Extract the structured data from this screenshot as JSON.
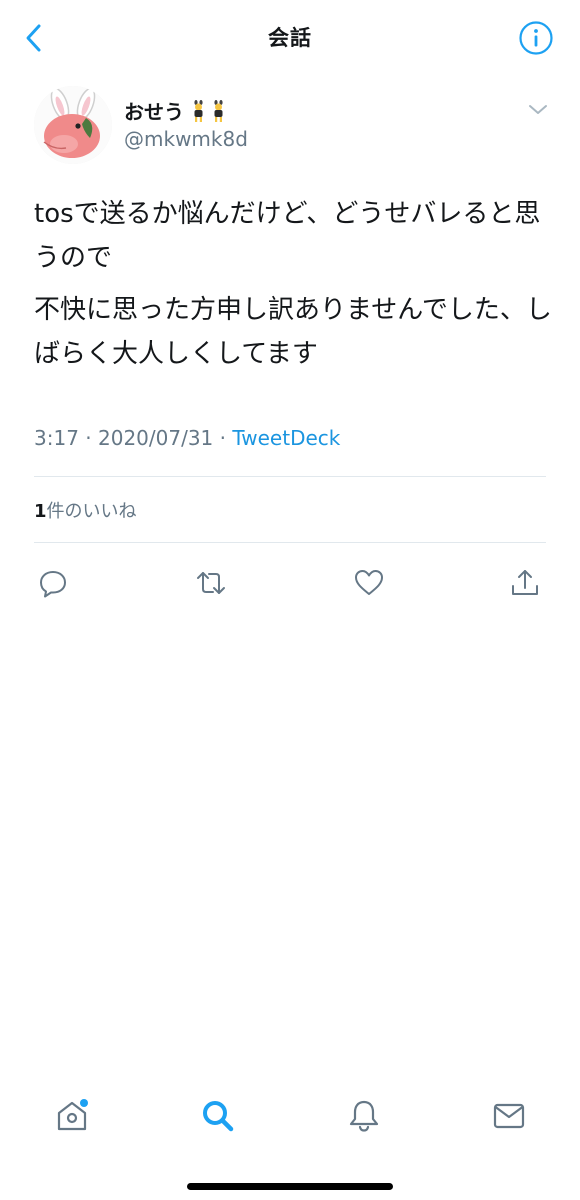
{
  "header": {
    "title": "会話",
    "back_icon": "chevron-left-icon",
    "info_icon": "info-icon"
  },
  "tweet": {
    "display_name": "おせう",
    "name_emoji": "dancers-emoji",
    "handle": "@mkwmk8d",
    "text_lines": [
      "tosで送るか悩んだけど、どうせバレると思うので",
      "不快に思った方申し訳ありませんでした、しばらく大人しくしてます"
    ],
    "time": "3:17",
    "date": "2020/07/31",
    "separator": "·",
    "client": "TweetDeck",
    "likes_count": "1",
    "likes_label": "件のいいね"
  },
  "actions": [
    "reply-icon",
    "retweet-icon",
    "like-icon",
    "share-icon"
  ],
  "tabbar": [
    "home-icon",
    "search-icon",
    "notifications-icon",
    "messages-icon"
  ],
  "colors": {
    "accent": "#1da1f2",
    "secondary_text": "#657786",
    "divider": "#e1e8ed",
    "icon_gray": "#657786"
  }
}
